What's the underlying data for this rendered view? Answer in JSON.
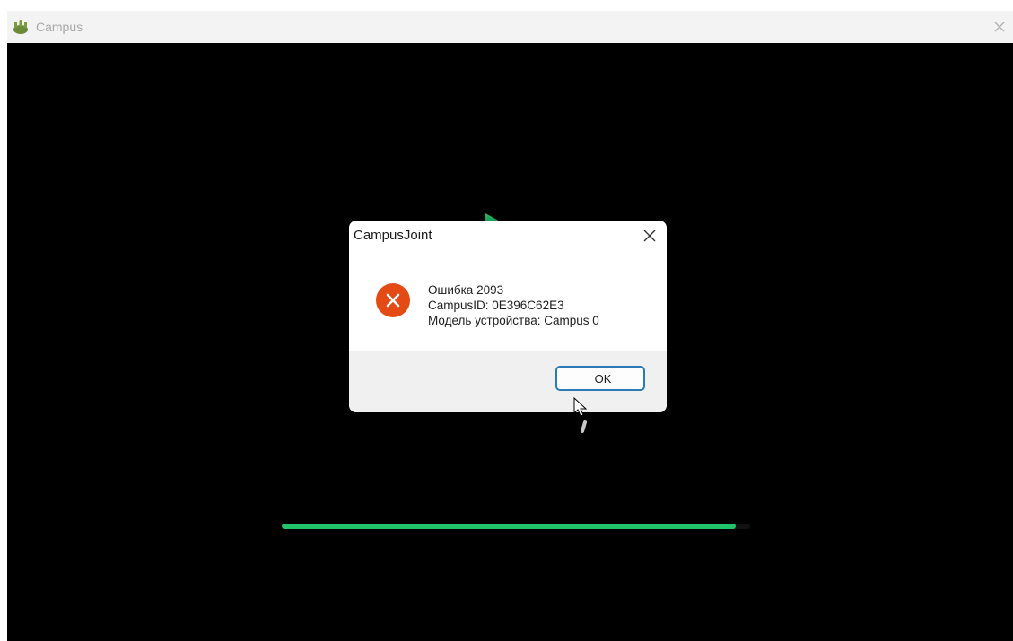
{
  "window": {
    "title": "Campus",
    "icon": "campus-app-icon",
    "close_icon": "close-icon"
  },
  "background": {
    "play_icon": "play-icon",
    "progress": 0.97,
    "accent": "#22c46a"
  },
  "dialog": {
    "title": "CampusJoint",
    "close_icon": "close-icon",
    "icon": "error-icon",
    "icon_color": "#e44b14",
    "message_lines": [
      "Ошибка 2093",
      "CampusID: 0E396C62E3",
      "Модель устройства: Campus 0"
    ],
    "ok_label": "OK",
    "ok_border_color": "#2a7ab8"
  },
  "cursor": "mouse-pointer-icon"
}
